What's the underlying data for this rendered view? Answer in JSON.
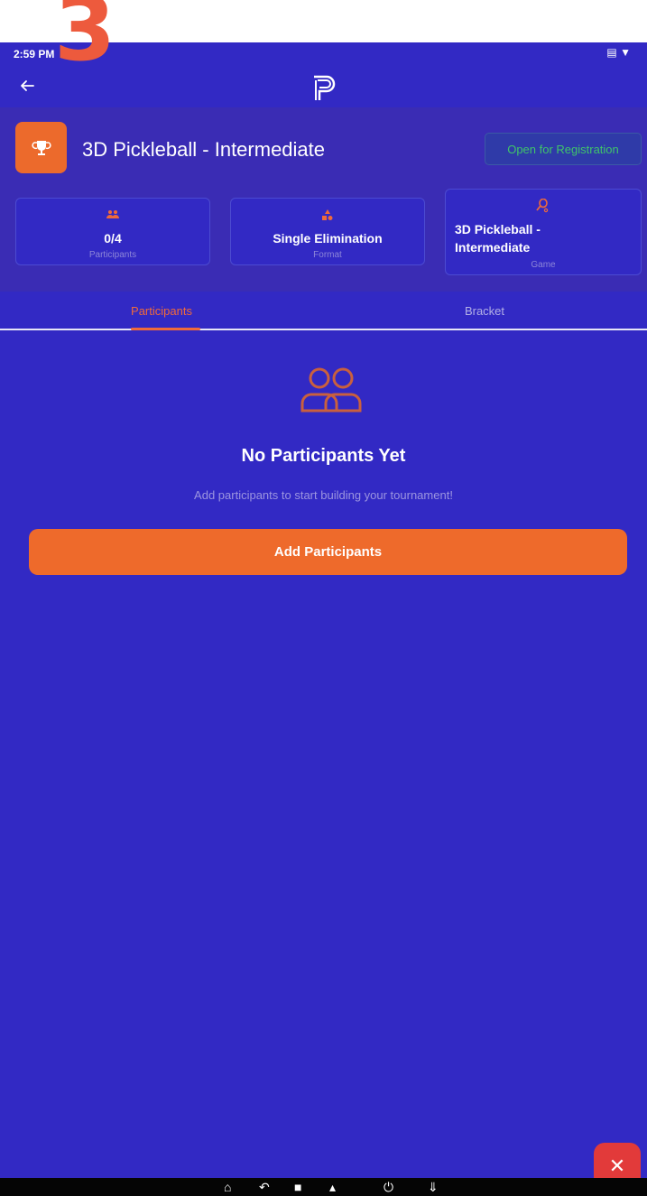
{
  "overlay": {
    "step_number": "3"
  },
  "status_bar": {
    "time": "2:59 PM",
    "left_icons": [
      "check-circle-icon",
      "do-not-disturb-icon",
      "shield-icon"
    ],
    "right_icons": [
      "cast-icon",
      "wifi-icon"
    ]
  },
  "app_bar": {
    "back_icon": "arrow-left-icon",
    "logo_icon": "app-logo-p-icon"
  },
  "tournament": {
    "title": "3D Pickleball - Intermediate",
    "status": "Open for Registration",
    "status_color": "#3fc46a",
    "icon": "trophy-icon"
  },
  "cards": {
    "participants": {
      "value": "0/4",
      "label": "Participants",
      "icon": "people-icon"
    },
    "format": {
      "value": "Single Elimination",
      "label": "Format",
      "icon": "shapes-icon"
    },
    "game": {
      "value": "3D Pickleball - Intermediate",
      "label": "Game",
      "icon": "paddle-icon"
    }
  },
  "tabs": [
    {
      "label": "Participants",
      "active": true
    },
    {
      "label": "Bracket",
      "active": false
    }
  ],
  "empty_state": {
    "icon": "two-people-outline-icon",
    "title": "No Participants Yet",
    "subtitle": "Add participants to start building your tournament!"
  },
  "actions": {
    "add_participants_label": "Add Participants",
    "fab_icon": "close-icon"
  },
  "nav_bar": {
    "items": [
      "home-icon",
      "back-icon",
      "recents-icon",
      "volume-icon",
      "power-icon",
      "expand-icon"
    ]
  },
  "colors": {
    "background": "#3229c4",
    "header_panel": "#3a2cb4",
    "accent": "#ee6a2b",
    "fab": "#e23a3a"
  }
}
